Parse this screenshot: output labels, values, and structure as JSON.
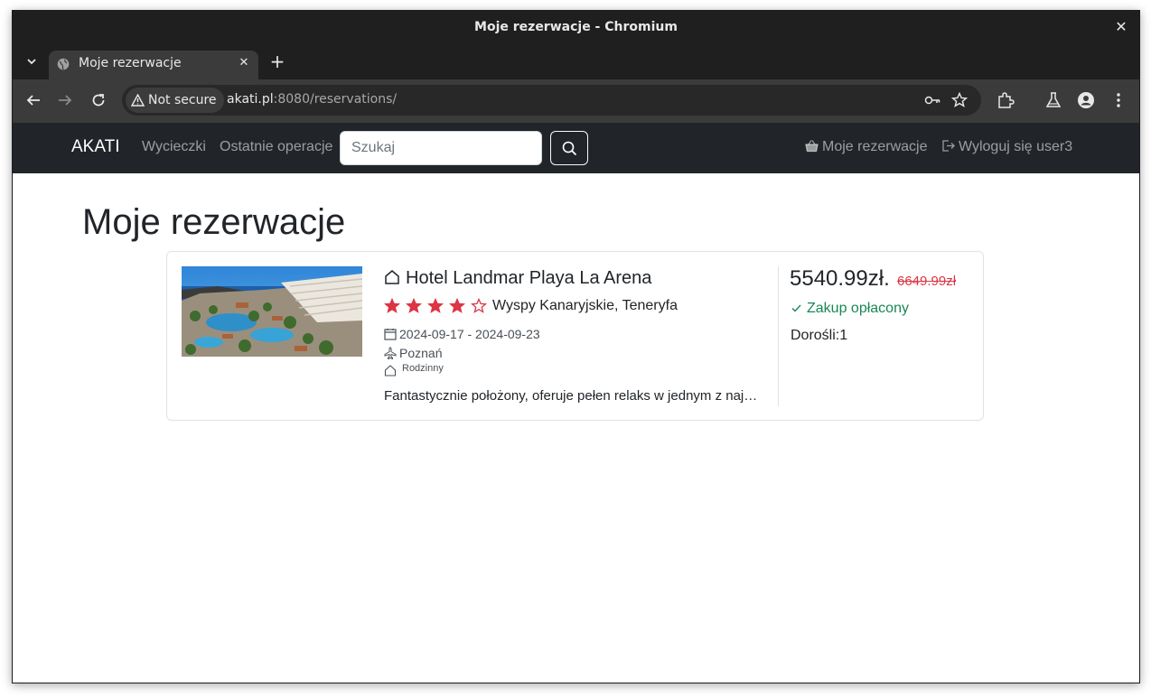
{
  "window": {
    "title": "Moje rezerwacje - Chromium"
  },
  "tab": {
    "label": "Moje rezerwacje"
  },
  "omnibox": {
    "security_label": "Not secure",
    "url_host": "akati.pl",
    "url_rest": ":8080/reservations/"
  },
  "nav": {
    "brand": "AKATI",
    "links": [
      "Wycieczki",
      "Ostatnie operacje"
    ],
    "search_placeholder": "Szukaj",
    "reservations_label": "Moje rezerwacje",
    "logout_label": "Wyloguj się user3"
  },
  "page": {
    "title": "Moje rezerwacje"
  },
  "reservation": {
    "hotel_name": "Hotel Landmar Playa La Arena",
    "rating": 4,
    "rating_max": 5,
    "location": "Wyspy Kanaryjskie, Teneryfa",
    "dates": "2024-09-17 - 2024-09-23",
    "departure": "Poznań",
    "type": "Rodzinny",
    "description": "Fantastycznie położony, oferuje pełen relaks w jednym z najpiękniejszych miejsc",
    "price": "5540.99zł.",
    "old_price": "6649.99zł",
    "status": "Zakup opłacony",
    "adults_label": "Dorośli:",
    "adults_count": "1"
  },
  "colors": {
    "navbar": "#212529",
    "star": "#dc3545",
    "status": "#198754",
    "old_price": "#dc3545"
  }
}
